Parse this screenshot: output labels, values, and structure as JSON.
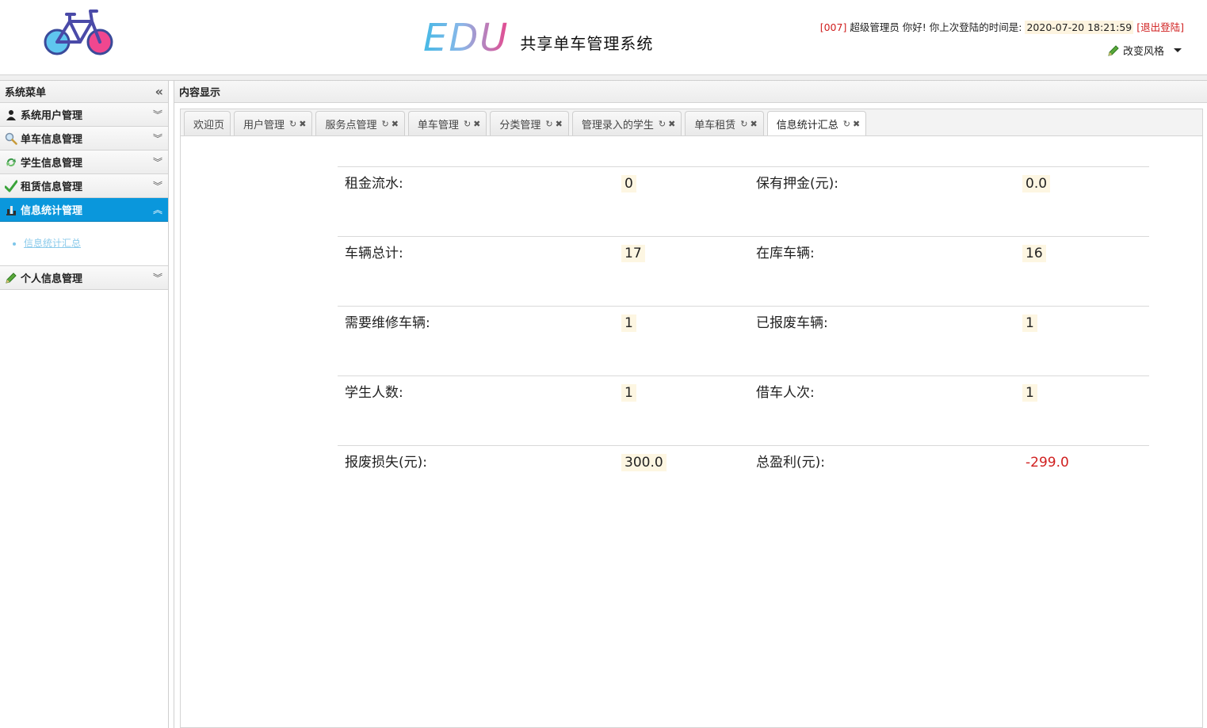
{
  "header": {
    "brand_edu": "EDU",
    "brand_text": "共享单车管理系统",
    "user": {
      "id": "[007]",
      "greeting": "超级管理员 你好! 你上次登陆的时间是:",
      "last_login": "2020-07-20 18:21:59",
      "logout": "[退出登陆]"
    },
    "style_switch": "改变风格"
  },
  "sidebar": {
    "title": "系统菜单",
    "menus": [
      {
        "label": "系统用户管理",
        "icon": "user-icon"
      },
      {
        "label": "单车信息管理",
        "icon": "search-icon"
      },
      {
        "label": "学生信息管理",
        "icon": "recycle-icon"
      },
      {
        "label": "租赁信息管理",
        "icon": "check-icon"
      },
      {
        "label": "信息统计管理",
        "icon": "chart-icon",
        "expanded": true,
        "children": [
          "信息统计汇总"
        ]
      },
      {
        "label": "个人信息管理",
        "icon": "pencil-icon"
      }
    ]
  },
  "content": {
    "title": "内容显示",
    "tabs": [
      "欢迎页",
      "用户管理",
      "服务点管理",
      "单车管理",
      "分类管理",
      "管理录入的学生",
      "单车租赁",
      "信息统计汇总"
    ],
    "active_tab": "信息统计汇总"
  },
  "stats": [
    {
      "l1": "租金流水:",
      "v1": "0",
      "l2": "保有押金(元):",
      "v2": "0.0"
    },
    {
      "l1": "车辆总计:",
      "v1": "17",
      "l2": "在库车辆:",
      "v2": "16"
    },
    {
      "l1": "需要维修车辆:",
      "v1": "1",
      "l2": "已报废车辆:",
      "v2": "1"
    },
    {
      "l1": "学生人数:",
      "v1": "1",
      "l2": "借车人次:",
      "v2": "1"
    },
    {
      "l1": "报废损失(元):",
      "v1": "300.0",
      "l2": "总盈利(元):",
      "v2": "-299.0"
    }
  ],
  "colors": {
    "accent": "#0a97dc",
    "danger": "#d01f1f",
    "value_bg": "#fdf6e2"
  }
}
